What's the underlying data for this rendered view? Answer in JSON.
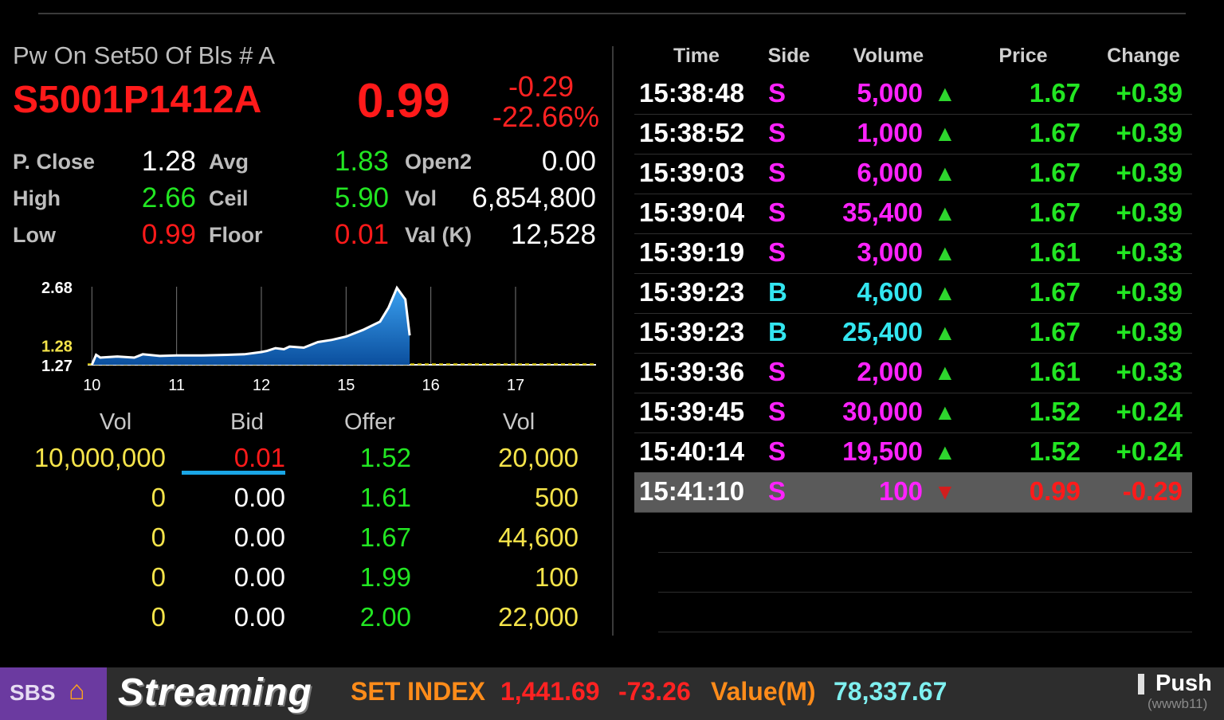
{
  "header": {
    "name": "Pw On Set50 Of Bls # A",
    "symbol": "S5001P1412A",
    "last": "0.99",
    "change": "-0.29",
    "change_pct": "-22.66%"
  },
  "stats": {
    "p_close_label": "P. Close",
    "p_close": "1.28",
    "avg_label": "Avg",
    "avg": "1.83",
    "open2_label": "Open2",
    "open2": "0.00",
    "high_label": "High",
    "high": "2.66",
    "ceil_label": "Ceil",
    "ceil": "5.90",
    "vol_label": "Vol",
    "vol": "6,854,800",
    "low_label": "Low",
    "low": "0.99",
    "floor_label": "Floor",
    "floor": "0.01",
    "val_label": "Val (K)",
    "val": "12,528"
  },
  "chart_data": {
    "type": "area",
    "y_labels": [
      "2.68",
      "1.28",
      "1.27"
    ],
    "x_ticks": [
      "10",
      "11",
      "12",
      "15",
      "16",
      "17"
    ],
    "x": [
      10.0,
      10.05,
      10.1,
      10.3,
      10.5,
      10.6,
      10.8,
      11.0,
      11.3,
      11.6,
      11.8,
      12.0,
      12.2,
      12.5,
      12.8,
      13.0,
      13.5,
      14.0,
      14.5,
      15.0,
      15.2,
      15.4,
      15.5,
      15.6,
      15.7,
      15.75
    ],
    "y": [
      1.27,
      1.45,
      1.4,
      1.42,
      1.4,
      1.46,
      1.43,
      1.44,
      1.44,
      1.45,
      1.46,
      1.5,
      1.52,
      1.57,
      1.55,
      1.6,
      1.58,
      1.68,
      1.72,
      1.78,
      1.9,
      2.05,
      2.3,
      2.66,
      2.45,
      1.8
    ],
    "ylim": [
      1.27,
      2.68
    ],
    "prev_close": 1.28,
    "colors": {
      "fill": "#1f7fd6",
      "line": "#ffffff",
      "prev_close_line": "#d6c400"
    }
  },
  "orderbook": {
    "headers": {
      "bid_vol": "Vol",
      "bid": "Bid",
      "offer": "Offer",
      "offer_vol": "Vol"
    },
    "rows": [
      {
        "bid_vol": "10,000,000",
        "bid": "0.01",
        "offer": "1.52",
        "offer_vol": "20,000"
      },
      {
        "bid_vol": "0",
        "bid": "0.00",
        "offer": "1.61",
        "offer_vol": "500"
      },
      {
        "bid_vol": "0",
        "bid": "0.00",
        "offer": "1.67",
        "offer_vol": "44,600"
      },
      {
        "bid_vol": "0",
        "bid": "0.00",
        "offer": "1.99",
        "offer_vol": "100"
      },
      {
        "bid_vol": "0",
        "bid": "0.00",
        "offer": "2.00",
        "offer_vol": "22,000"
      }
    ]
  },
  "ticks": {
    "headers": {
      "time": "Time",
      "side": "Side",
      "volume": "Volume",
      "price": "Price",
      "change": "Change"
    },
    "rows": [
      {
        "time": "15:38:48",
        "side": "S",
        "volume": "5,000",
        "dir": "up",
        "price": "1.67",
        "change": "+0.39"
      },
      {
        "time": "15:38:52",
        "side": "S",
        "volume": "1,000",
        "dir": "up",
        "price": "1.67",
        "change": "+0.39"
      },
      {
        "time": "15:39:03",
        "side": "S",
        "volume": "6,000",
        "dir": "up",
        "price": "1.67",
        "change": "+0.39"
      },
      {
        "time": "15:39:04",
        "side": "S",
        "volume": "35,400",
        "dir": "up",
        "price": "1.67",
        "change": "+0.39"
      },
      {
        "time": "15:39:19",
        "side": "S",
        "volume": "3,000",
        "dir": "up",
        "price": "1.61",
        "change": "+0.33"
      },
      {
        "time": "15:39:23",
        "side": "B",
        "volume": "4,600",
        "dir": "up",
        "price": "1.67",
        "change": "+0.39"
      },
      {
        "time": "15:39:23",
        "side": "B",
        "volume": "25,400",
        "dir": "up",
        "price": "1.67",
        "change": "+0.39"
      },
      {
        "time": "15:39:36",
        "side": "S",
        "volume": "2,000",
        "dir": "up",
        "price": "1.61",
        "change": "+0.33"
      },
      {
        "time": "15:39:45",
        "side": "S",
        "volume": "30,000",
        "dir": "up",
        "price": "1.52",
        "change": "+0.24"
      },
      {
        "time": "15:40:14",
        "side": "S",
        "volume": "19,500",
        "dir": "up",
        "price": "1.52",
        "change": "+0.24"
      },
      {
        "time": "15:41:10",
        "side": "S",
        "volume": "100",
        "dir": "down",
        "price": "0.99",
        "change": "-0.29"
      }
    ]
  },
  "bottom_bar": {
    "logo_text": "SBS",
    "brand": "Streaming",
    "index_label": "SET INDEX",
    "index_value": "1,441.69",
    "index_change": "-73.26",
    "value_label": "Value(M)",
    "value": "78,337.67",
    "push_label": "Push",
    "push_id": "(wwwb11)"
  },
  "colors": {
    "red": "#ff1a1a",
    "green": "#22e622",
    "yellow": "#f5e44a",
    "magenta": "#ff22ff",
    "cyan": "#33e6f0",
    "orange": "#ff8c1a"
  }
}
